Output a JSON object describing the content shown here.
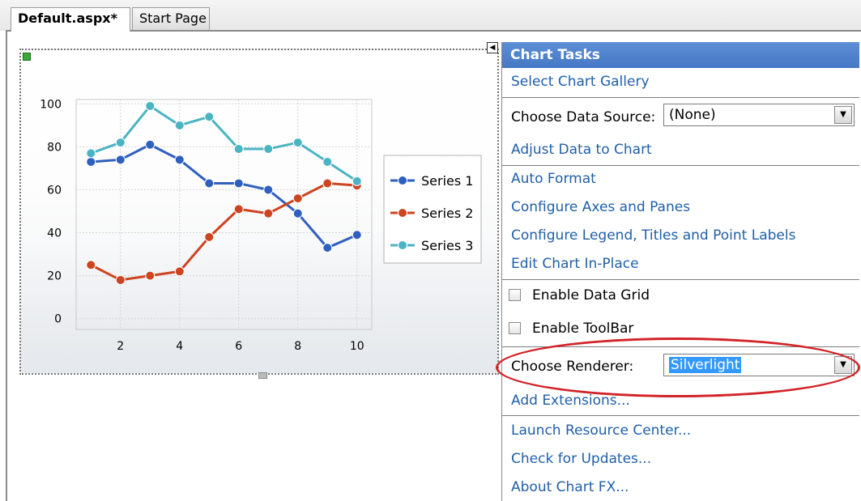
{
  "tabs": [
    {
      "label": "Default.aspx*",
      "active": true
    },
    {
      "label": "Start Page",
      "active": false
    }
  ],
  "smart_tag_glyph": "◀",
  "chart_tasks": {
    "title": "Chart Tasks",
    "select_gallery": "Select Chart Gallery",
    "data_source_label": "Choose Data Source:",
    "data_source_value": "(None)",
    "adjust_data": "Adjust Data to Chart",
    "auto_format": "Auto Format",
    "configure_axes": "Configure Axes and Panes",
    "configure_legend": "Configure Legend, Titles and Point Labels",
    "edit_in_place": "Edit Chart In-Place",
    "enable_data_grid": "Enable Data Grid",
    "enable_toolbar": "Enable ToolBar",
    "renderer_label": "Choose Renderer:",
    "renderer_value": "Silverlight",
    "add_extensions": "Add Extensions...",
    "launch_resource": "Launch Resource Center...",
    "check_updates": "Check for Updates...",
    "about": "About Chart FX..."
  },
  "colors": {
    "header_blue": "#4f83cc",
    "link_blue": "#1f5fa8",
    "highlight_red": "#d22328",
    "series1": "#2f5fbf",
    "series2": "#cc4420",
    "series3": "#4bb4c2"
  },
  "chart_data": {
    "type": "line",
    "x": [
      1,
      2,
      3,
      4,
      5,
      6,
      7,
      8,
      9,
      10
    ],
    "xticks": [
      2,
      4,
      6,
      8,
      10
    ],
    "yticks": [
      0,
      20,
      40,
      60,
      80,
      100
    ],
    "xlim": [
      0.5,
      10.5
    ],
    "ylim": [
      -5,
      102
    ],
    "grid": true,
    "legend_position": "right",
    "series": [
      {
        "name": "Series 1",
        "color": "#2f5fbf",
        "values": [
          73,
          74,
          81,
          74,
          63,
          63,
          60,
          49,
          33,
          39
        ]
      },
      {
        "name": "Series 2",
        "color": "#cc4420",
        "values": [
          25,
          18,
          20,
          22,
          38,
          51,
          49,
          56,
          63,
          62
        ]
      },
      {
        "name": "Series 3",
        "color": "#4bb4c2",
        "values": [
          77,
          82,
          99,
          90,
          94,
          79,
          79,
          82,
          73,
          64
        ]
      }
    ]
  }
}
